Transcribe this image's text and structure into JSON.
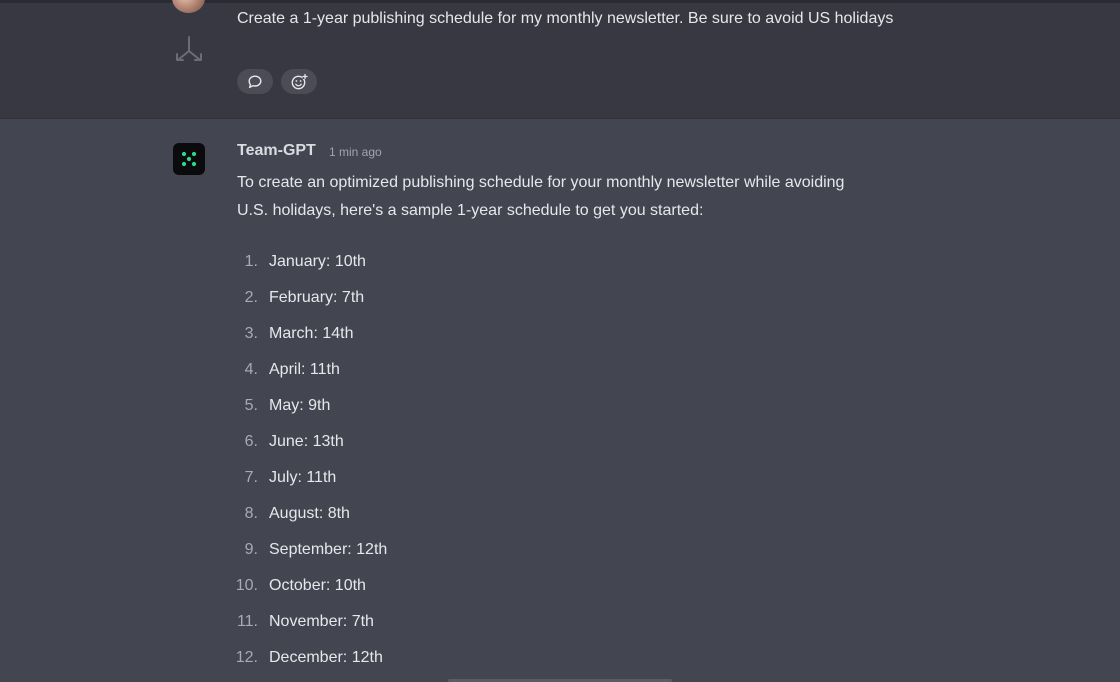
{
  "user_message": {
    "text": "Create a 1-year publishing schedule for my monthly newsletter. Be sure to avoid US holidays",
    "actions": [
      {
        "icon": "comment-icon"
      },
      {
        "icon": "add-reaction-icon"
      }
    ],
    "side_icon": "branch-icon"
  },
  "bot_message": {
    "author": "Team-GPT",
    "time": "1 min ago",
    "intro": "To create an optimized publishing schedule for your monthly newsletter while avoiding U.S. holidays, here's a sample 1-year schedule to get you started:",
    "schedule": [
      {
        "num": "1.",
        "text": "January: 10th"
      },
      {
        "num": "2.",
        "text": "February: 7th"
      },
      {
        "num": "3.",
        "text": "March: 14th"
      },
      {
        "num": "4.",
        "text": "April: 11th"
      },
      {
        "num": "5.",
        "text": "May: 9th"
      },
      {
        "num": "6.",
        "text": "June: 13th"
      },
      {
        "num": "7.",
        "text": "July: 11th"
      },
      {
        "num": "8.",
        "text": "August: 8th"
      },
      {
        "num": "9.",
        "text": "September: 12th"
      },
      {
        "num": "10.",
        "text": "October: 10th"
      },
      {
        "num": "11.",
        "text": "November: 7th"
      },
      {
        "num": "12.",
        "text": "December: 12th"
      }
    ]
  },
  "colors": {
    "background": "#434551",
    "user_block": "#373841",
    "bot_logo_dots": "#2bd98b",
    "text": "#e7e7ea"
  }
}
